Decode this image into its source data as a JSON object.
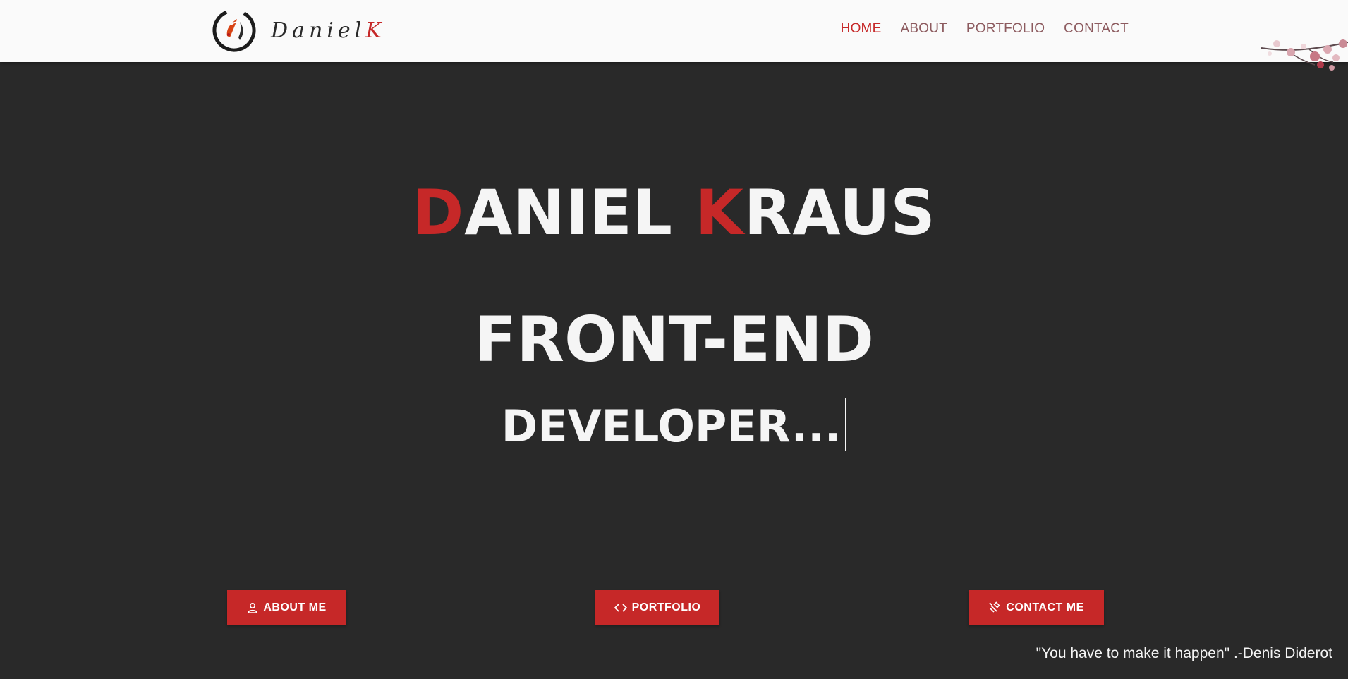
{
  "brand": {
    "logo_prefix": "Daniel",
    "logo_accent": "K",
    "colors": {
      "accent": "#c62828",
      "background": "#292929",
      "navbar": "#fafafa",
      "nav_text": "#8c5a5e"
    }
  },
  "nav": {
    "items": [
      {
        "label": "HOME",
        "active": true
      },
      {
        "label": "ABOUT",
        "active": false
      },
      {
        "label": "PORTFOLIO",
        "active": false
      },
      {
        "label": "CONTACT",
        "active": false
      }
    ]
  },
  "hero": {
    "first_initial": "D",
    "first_rest": "ANIEL",
    "last_initial": "K",
    "last_rest": "RAUS",
    "role_line1": "FRONT-END",
    "role_line2": "DEVELOPER..."
  },
  "buttons": {
    "about": {
      "label": "ABOUT ME",
      "icon": "person-icon"
    },
    "portfolio": {
      "label": "PORTFOLIO",
      "icon": "code-icon"
    },
    "contact": {
      "label": "CONTACT ME",
      "icon": "satellite-icon"
    }
  },
  "quote": "\"You have to make it happen\" .-Denis Diderot"
}
